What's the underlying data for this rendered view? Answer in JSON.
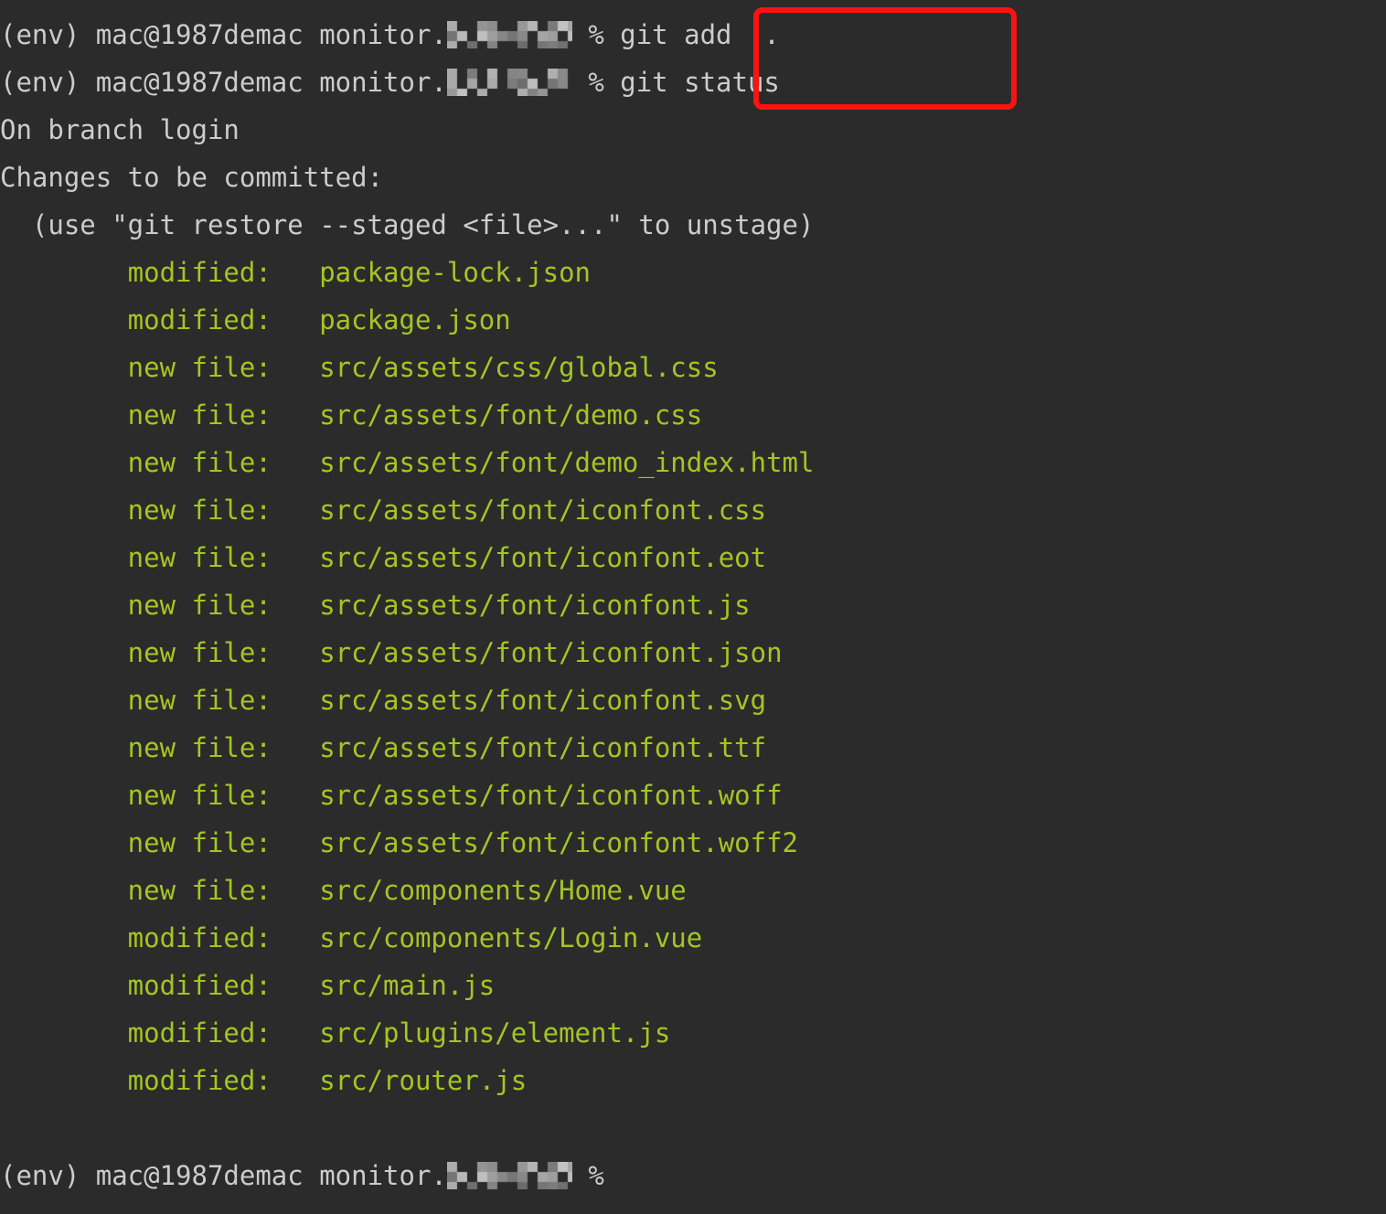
{
  "terminal": {
    "background_color": "#2b2b2b",
    "text_color": "#c9c9c9",
    "file_color": "#a5c522",
    "highlight_color": "#fb1212",
    "shell_symbol": "%",
    "prompt": {
      "env": "(env)",
      "user_host": "mac@1987demac",
      "path_visible": "monitor.",
      "path_redacted": true
    },
    "commands": {
      "add": "git add  .",
      "status": "git status"
    },
    "status_output": {
      "branch_line": "On branch login",
      "changes_header": "Changes to be committed:",
      "hint_line": "  (use \"git restore --staged <file>...\" to unstage)"
    },
    "files": [
      {
        "status": "modified:",
        "path": "package-lock.json"
      },
      {
        "status": "modified:",
        "path": "package.json"
      },
      {
        "status": "new file:",
        "path": "src/assets/css/global.css"
      },
      {
        "status": "new file:",
        "path": "src/assets/font/demo.css"
      },
      {
        "status": "new file:",
        "path": "src/assets/font/demo_index.html"
      },
      {
        "status": "new file:",
        "path": "src/assets/font/iconfont.css"
      },
      {
        "status": "new file:",
        "path": "src/assets/font/iconfont.eot"
      },
      {
        "status": "new file:",
        "path": "src/assets/font/iconfont.js"
      },
      {
        "status": "new file:",
        "path": "src/assets/font/iconfont.json"
      },
      {
        "status": "new file:",
        "path": "src/assets/font/iconfont.svg"
      },
      {
        "status": "new file:",
        "path": "src/assets/font/iconfont.ttf"
      },
      {
        "status": "new file:",
        "path": "src/assets/font/iconfont.woff"
      },
      {
        "status": "new file:",
        "path": "src/assets/font/iconfont.woff2"
      },
      {
        "status": "new file:",
        "path": "src/components/Home.vue"
      },
      {
        "status": "modified:",
        "path": "src/components/Login.vue"
      },
      {
        "status": "modified:",
        "path": "src/main.js"
      },
      {
        "status": "modified:",
        "path": "src/plugins/element.js"
      },
      {
        "status": "modified:",
        "path": "src/router.js"
      }
    ]
  }
}
